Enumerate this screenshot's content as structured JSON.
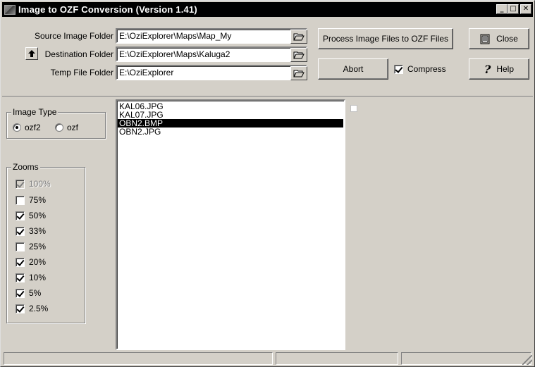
{
  "window": {
    "title": "Image to OZF Conversion (Version 1.41)",
    "minimize_glyph": "_",
    "maximize_glyph": "□",
    "close_glyph": "✕"
  },
  "folders": {
    "source_label": "Source Image Folder",
    "source_value": "E:\\OziExplorer\\Maps\\Map_My",
    "destination_label": "Destination Folder",
    "destination_value": "E:\\OziExplorer\\Maps\\Kaluga2",
    "temp_label": "Temp File Folder",
    "temp_value": "E:\\OziExplorer"
  },
  "actions": {
    "process_label": "Process Image Files to OZF Files",
    "abort_label": "Abort",
    "compress_label": "Compress",
    "compress_checked": true,
    "close_label": "Close",
    "help_label": "Help"
  },
  "image_type": {
    "title": "Image Type",
    "options": [
      {
        "label": "ozf2",
        "selected": true
      },
      {
        "label": "ozf",
        "selected": false
      }
    ]
  },
  "zooms": {
    "title": "Zooms",
    "items": [
      {
        "label": "100%",
        "checked": true,
        "disabled": true
      },
      {
        "label": "75%",
        "checked": false,
        "disabled": false
      },
      {
        "label": "50%",
        "checked": true,
        "disabled": false
      },
      {
        "label": "33%",
        "checked": true,
        "disabled": false
      },
      {
        "label": "25%",
        "checked": false,
        "disabled": false
      },
      {
        "label": "20%",
        "checked": true,
        "disabled": false
      },
      {
        "label": "10%",
        "checked": true,
        "disabled": false
      },
      {
        "label": "5%",
        "checked": true,
        "disabled": false
      },
      {
        "label": "2.5%",
        "checked": true,
        "disabled": false
      }
    ]
  },
  "files": {
    "items": [
      {
        "name": "KAL06.JPG",
        "selected": false
      },
      {
        "name": "KAL07.JPG",
        "selected": false
      },
      {
        "name": "OBN2.BMP",
        "selected": true
      },
      {
        "name": "OBN2.JPG",
        "selected": false
      }
    ]
  },
  "status": {
    "seg1": "",
    "seg2": "",
    "seg3": ""
  },
  "colors": {
    "face": "#d4d0c8",
    "titlebar": "#000000",
    "selection": "#000000"
  }
}
